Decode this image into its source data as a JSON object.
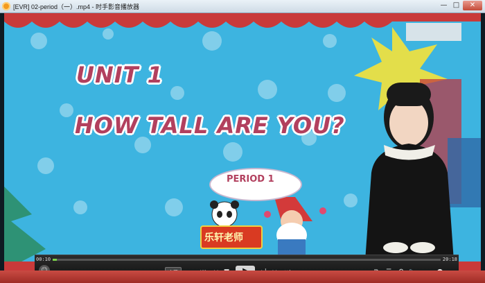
{
  "window": {
    "title": "[EVR] 02-period（一）.mp4 - 时手影音播放器",
    "minimize_glyph": "—",
    "maximize_glyph": "□",
    "close_glyph": "✕"
  },
  "slide": {
    "unit_title": "UNIT 1",
    "lesson_title": "HOW TALL ARE YOU?",
    "period_label": "PERIOD 1",
    "sign_text": "乐轩老师"
  },
  "player": {
    "current_time": "00:10",
    "total_time": "20:18",
    "progress_fraction": 0.01,
    "volume_fraction": 0.6,
    "subtitle_label": "字幕",
    "buttons": {
      "avatar": "☺",
      "prev": "⏮",
      "rewind": "◂◂",
      "stop": "■",
      "play": "▶",
      "step": "▸|",
      "forward": "▸▸",
      "next": "⏭",
      "capture": "⧉",
      "playlist": "☰",
      "settings": "⚙",
      "volume": "🔈"
    }
  },
  "colors": {
    "slide_background": "#3db4e0",
    "title_text": "#b2405e",
    "progress_fill": "#7ad04a",
    "volume_fill": "#d33"
  }
}
